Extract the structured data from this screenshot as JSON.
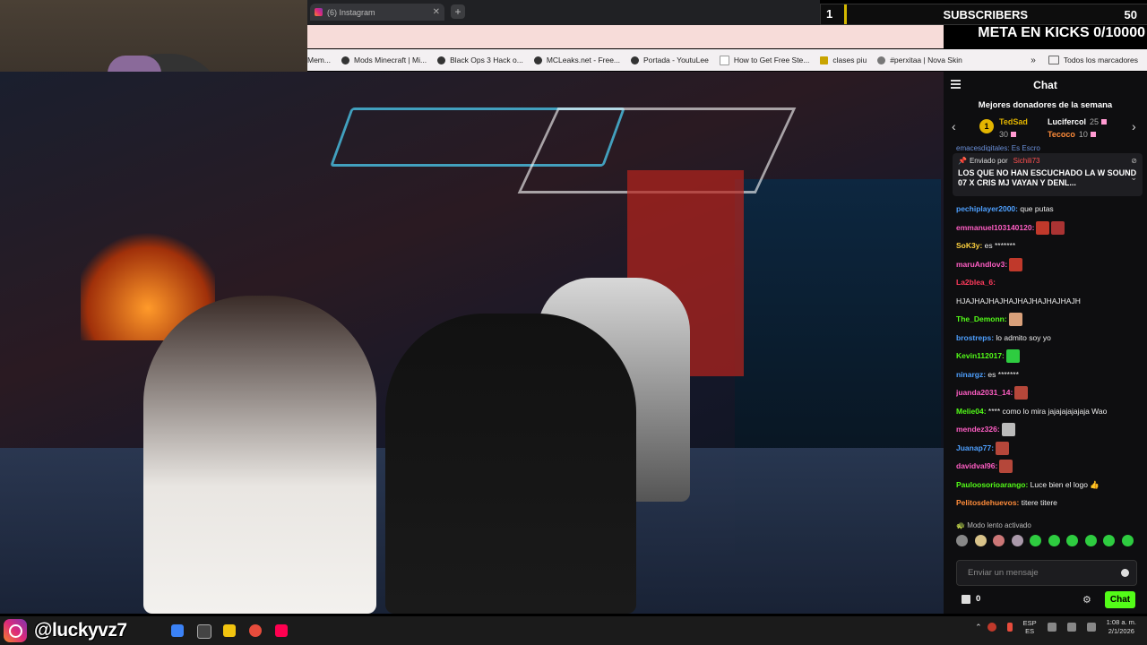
{
  "browser": {
    "tab_title": "(6) Instagram",
    "tab_close": "✕",
    "new_tab": "+",
    "bookmarks": [
      "Mem...",
      "Mods Minecraft | Mi...",
      "Black Ops 3 Hack o...",
      "MCLeaks.net - Free...",
      "Portada - YoutuLee",
      "How to Get Free Ste...",
      "clases piu",
      "#perxitaa | Nova Skin"
    ],
    "bookmarks_more": "»",
    "all_bookmarks": "Todos los marcadores"
  },
  "overlay": {
    "subs_left": "1",
    "subs_label": "SUBSCRIBERS",
    "subs_right": "50",
    "meta_text": "META EN KICKS 0/10000"
  },
  "chat": {
    "title": "Chat",
    "donors_title": "Mejores donadores de la semana",
    "donors": [
      {
        "name": "TedSad",
        "value": "30",
        "color": "#e3b500"
      },
      {
        "name": "Lucifercol",
        "value": "25",
        "color": "#ffffff"
      },
      {
        "name": "Tecoco",
        "value": "10",
        "color": "#ff8c3a"
      }
    ],
    "donor_rank": "1",
    "prev_arrow": "‹",
    "next_arrow": "›",
    "partial_top": "emacesdigitales: Es Escro",
    "pinned": {
      "label": "Enviado por",
      "sender": "Sichili73",
      "message": "LOS QUE NO HAN ESCUCHADO LA W SOUND 07 X CRIS MJ VAYAN Y DENL..."
    },
    "messages": [
      {
        "user": "pechiplayer2000:",
        "text": " que putas",
        "color": "#4ea0ff",
        "emotes": []
      },
      {
        "user": "emmanuel103140120:",
        "text": "",
        "color": "#ff5ec4",
        "emotes": [
          "#c0392b",
          "#a33"
        ]
      },
      {
        "user": "SoK3y:",
        "text": " es *******",
        "color": "#ffd23f",
        "emotes": []
      },
      {
        "user": "maruAndlov3:",
        "text": "",
        "color": "#ff5ec4",
        "emotes": [
          "#c0392b"
        ]
      },
      {
        "user": "La2blea_6:",
        "text": "",
        "color": "#ff3b5c",
        "emotes": []
      },
      {
        "user": "",
        "text": "HJAJHAJHAJHAJHAJHAJHAJHAJH",
        "color": "#ffffff",
        "emotes": []
      },
      {
        "user": "The_Demonn:",
        "text": "",
        "color": "#53fc18",
        "emotes": [
          "#d9a07a"
        ]
      },
      {
        "user": "brostreps:",
        "text": " lo admito soy yo",
        "color": "#4ea0ff",
        "emotes": []
      },
      {
        "user": "Kevin112017:",
        "text": "",
        "color": "#53fc18",
        "emotes": [
          "#2ecc40"
        ]
      },
      {
        "user": "ninargz:",
        "text": " es *******",
        "color": "#4ea0ff",
        "emotes": []
      },
      {
        "user": "juanda2031_14:",
        "text": "",
        "color": "#ff5ec4",
        "emotes": [
          "#b5473a"
        ]
      },
      {
        "user": "Melie04:",
        "text": " **** como lo mira jajajajajajaja Wao",
        "color": "#53fc18",
        "emotes": []
      },
      {
        "user": "mendez326:",
        "text": "",
        "color": "#ff5ec4",
        "emotes": [
          "#bbbbbb"
        ]
      },
      {
        "user": "Juanap77:",
        "text": "",
        "color": "#4ea0ff",
        "emotes": [
          "#b5473a"
        ]
      },
      {
        "user": "davidval96:",
        "text": "",
        "color": "#ff5ec4",
        "emotes": [
          "#b5473a"
        ]
      },
      {
        "user": "Pauloosorioarango:",
        "text": " Luce bien el logo 👍",
        "color": "#53fc18",
        "emotes": []
      },
      {
        "user": "Pelitosdehuevos:",
        "text": " titere titere",
        "color": "#ff8c3a",
        "emotes": []
      }
    ],
    "slow_mode": "Modo lento activado",
    "emote_colors": [
      "#888",
      "#d9c38a",
      "#c77",
      "#a9a",
      "#2ecc40",
      "#2ecc40",
      "#2ecc40",
      "#2ecc40",
      "#2ecc40",
      "#2ecc40"
    ],
    "input_placeholder": "Enviar un mensaje",
    "gift_count": "0",
    "chat_button": "Chat"
  },
  "taskbar": {
    "handle": "@luckyvz7",
    "lang_top": "ESP",
    "lang_bottom": "ES",
    "time": "1:08 a. m.",
    "date": "2/1/2026"
  }
}
